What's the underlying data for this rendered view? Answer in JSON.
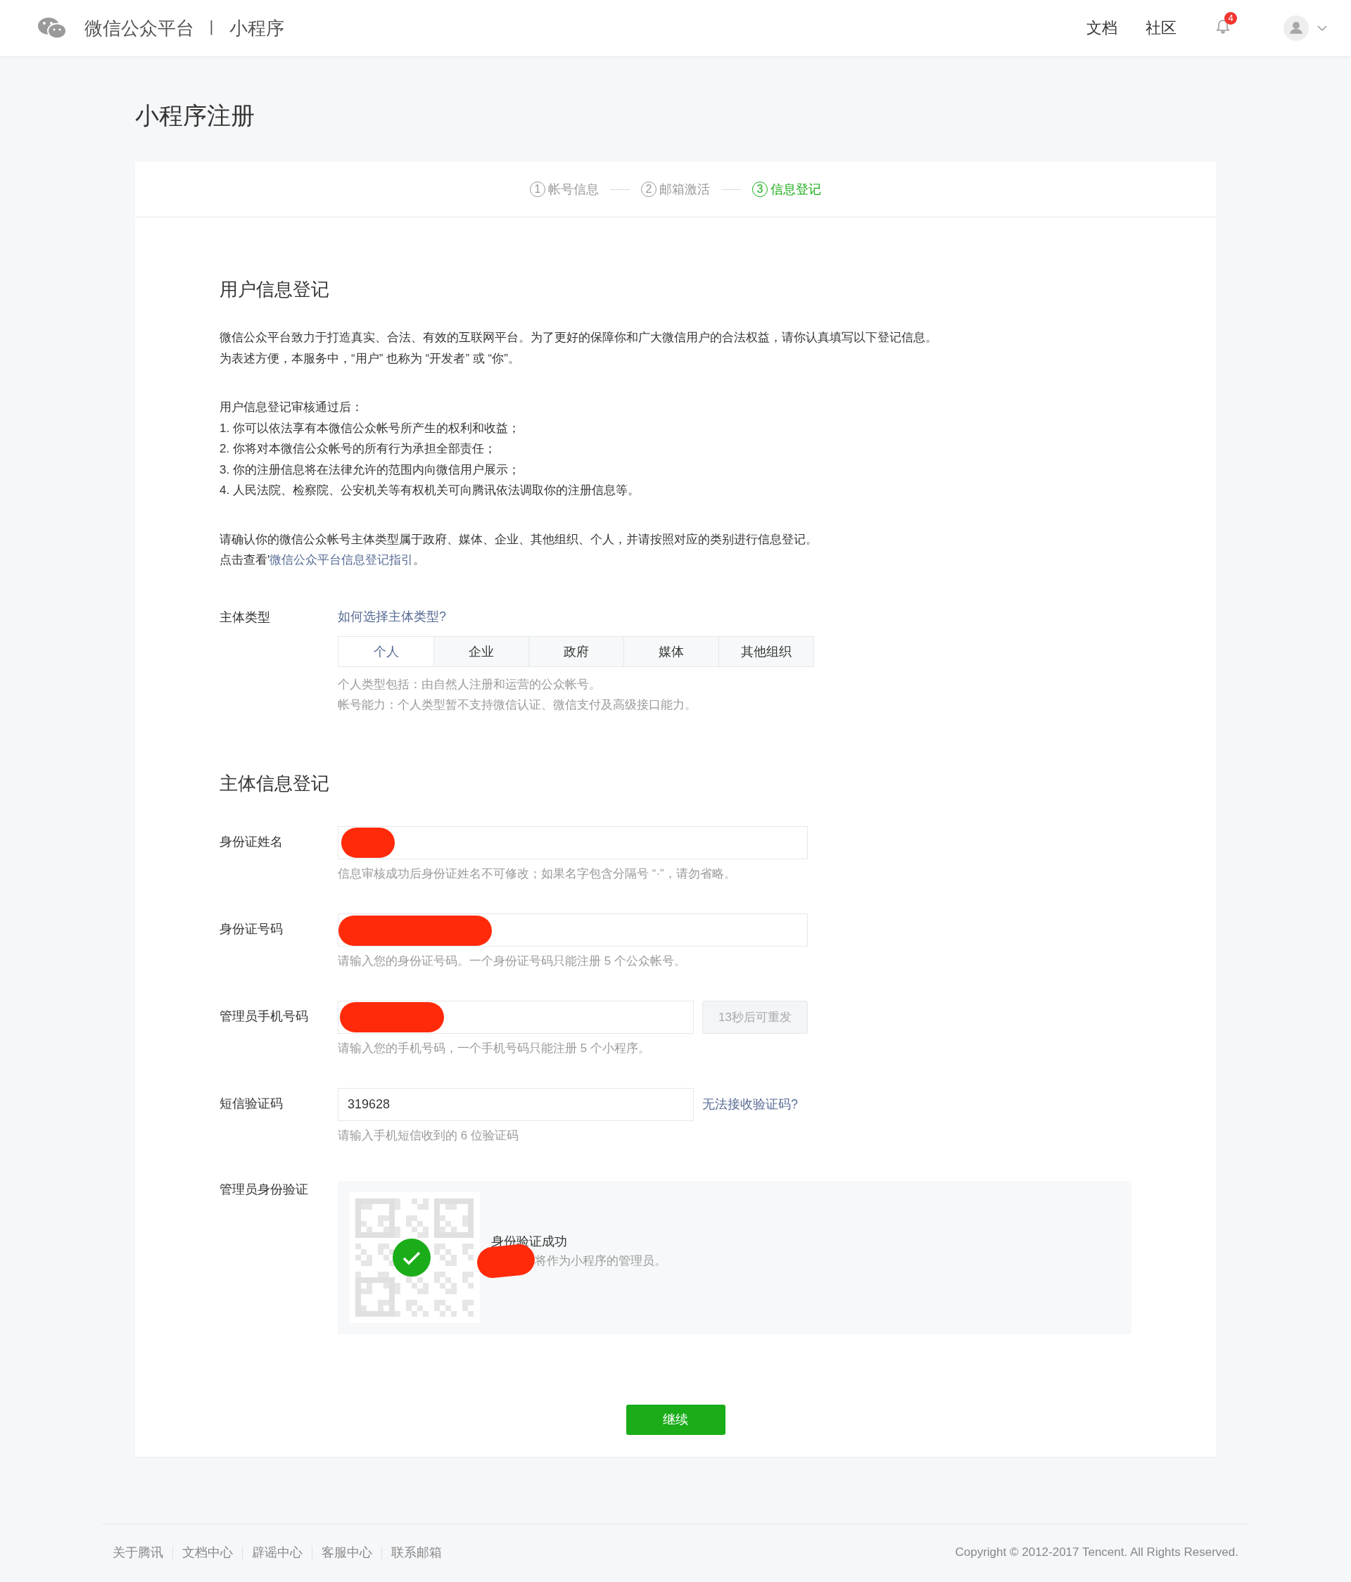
{
  "header": {
    "brand": "微信公众平台",
    "separator": "丨",
    "product": "小程序",
    "nav": [
      "文档",
      "社区"
    ],
    "notification_count": "4"
  },
  "page_title": "小程序注册",
  "steps": [
    {
      "number": "1",
      "label": "帐号信息",
      "selected": false
    },
    {
      "number": "2",
      "label": "邮箱激活",
      "selected": false
    },
    {
      "number": "3",
      "label": "信息登记",
      "selected": true
    }
  ],
  "user_info": {
    "heading": "用户信息登记",
    "intro": [
      "微信公众平台致力于打造真实、合法、有效的互联网平台。为了更好的保障你和广大微信用户的合法权益，请你认真填写以下登记信息。",
      "为表述方便，本服务中，“用户” 也称为 “开发者” 或 “你”。"
    ],
    "after_heading": "用户信息登记审核通过后：",
    "list": [
      "1. 你可以依法享有本微信公众帐号所产生的权利和收益；",
      "2. 你将对本微信公众帐号的所有行为承担全部责任；",
      "3. 你的注册信息将在法律允许的范围内向微信用户展示；",
      "4. 人民法院、检察院、公安机关等有权机关可向腾讯依法调取你的注册信息等。"
    ],
    "confirm": "请确认你的微信公众帐号主体类型属于政府、媒体、企业、其他组织、个人，并请按照对应的类别进行信息登记。",
    "guide_prefix": "点击查看'",
    "guide_link": "微信公众平台信息登记指引",
    "guide_suffix": "。"
  },
  "subject_type": {
    "label": "主体类型",
    "help_link": "如何选择主体类型?",
    "options": [
      {
        "label": "个人",
        "selected": true
      },
      {
        "label": "企业",
        "selected": false
      },
      {
        "label": "政府",
        "selected": false
      },
      {
        "label": "媒体",
        "selected": false
      },
      {
        "label": "其他组织",
        "selected": false
      }
    ],
    "hints": [
      "个人类型包括：由自然人注册和运营的公众帐号。",
      "帐号能力：个人类型暂不支持微信认证、微信支付及高级接口能力。"
    ]
  },
  "subject_info": {
    "heading": "主体信息登记",
    "fields": [
      {
        "kind": "text",
        "label": "身份证姓名",
        "redacted": true,
        "hint": "信息审核成功后身份证姓名不可修改；如果名字包含分隔号 “·”，请勿省略。"
      },
      {
        "kind": "text",
        "label": "身份证号码",
        "redacted": true,
        "hint": "请输入您的身份证号码。一个身份证号码只能注册 5 个公众帐号。"
      },
      {
        "kind": "button",
        "label": "管理员手机号码",
        "redacted": true,
        "action": "13秒后可重发",
        "disabled": true,
        "hint": "请输入您的手机号码，一个手机号码只能注册 5 个小程序。"
      },
      {
        "kind": "link",
        "label": "短信验证码",
        "value": "319628",
        "action": "无法接收验证码?",
        "hint": "请输入手机短信收到的 6 位验证码"
      }
    ],
    "verification": {
      "label": "管理员身份验证",
      "status": "身份验证成功",
      "description": "将作为小程序的管理员。",
      "redacted": true
    }
  },
  "submit": "继续",
  "footer": {
    "links": [
      "关于腾讯",
      "文档中心",
      "辟谣中心",
      "客服中心",
      "联系邮箱"
    ],
    "copyright": "Copyright © 2012-2017 Tencent. All Rights Reserved."
  }
}
